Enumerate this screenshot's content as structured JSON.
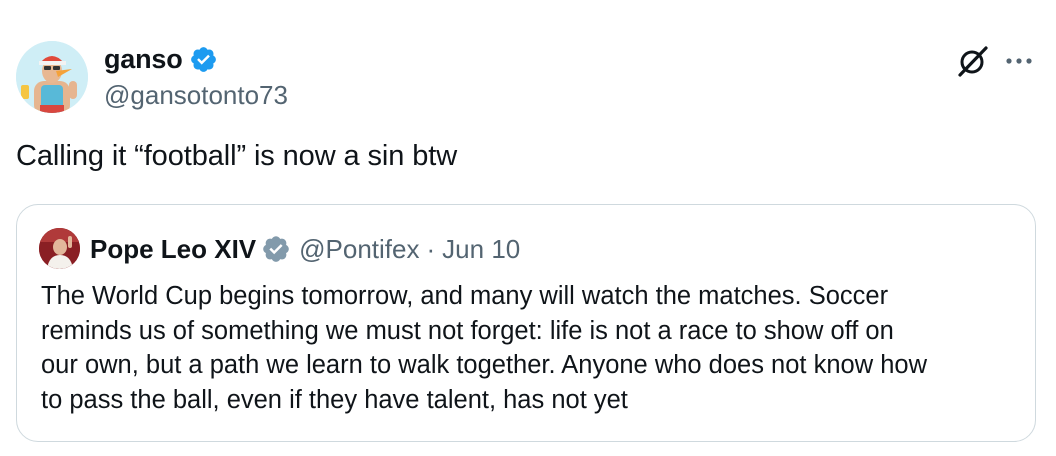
{
  "tweet": {
    "author": {
      "display_name": "ganso",
      "handle": "@gansotonto73",
      "verified": true
    },
    "text": "Calling it “football” is now a sin btw",
    "actions": {
      "grok_icon": "grok-icon",
      "more_icon": "more-icon"
    }
  },
  "quote": {
    "author": {
      "display_name": "Pope Leo XIV",
      "handle": "@Pontifex",
      "separator": "·",
      "date": "Jun 10",
      "verified": true,
      "badge_color": "#829aab"
    },
    "text_lines": [
      "The World Cup begins tomorrow, and many will watch the matches. Soccer",
      "reminds us of something we must not forget: life is not a race to show off on",
      "our own, but a path we learn to walk together. Anyone who does not know how",
      "to pass the ball, even if they have talent, has not yet"
    ]
  },
  "colors": {
    "verified_blue": "#1d9bf0",
    "text_primary": "#0f1419",
    "text_secondary": "#536471",
    "border": "#cfd9de"
  }
}
